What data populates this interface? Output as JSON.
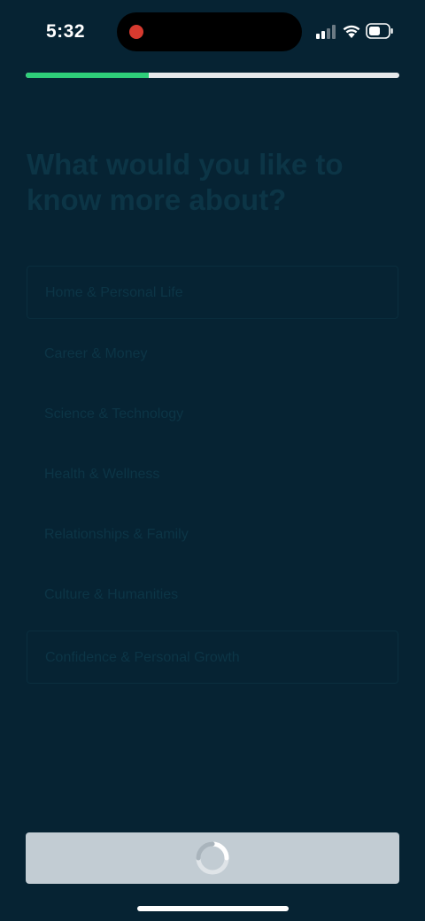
{
  "status_bar": {
    "time": "5:32",
    "signal_icon": "cellular-signal-icon",
    "wifi_icon": "wifi-icon",
    "battery_icon": "battery-icon",
    "recording_color": "#d63a2f"
  },
  "progress": {
    "value": 0.33,
    "fill_color": "#2ecf7a",
    "track_color": "#e6e8ea"
  },
  "step_label": "",
  "question": "What would you like to know more about?",
  "options": [
    {
      "label": "Home & Personal Life",
      "bordered": true
    },
    {
      "label": "Career & Money",
      "bordered": false
    },
    {
      "label": "Science & Technology",
      "bordered": false
    },
    {
      "label": "Health & Wellness",
      "bordered": false
    },
    {
      "label": "Relationships & Family",
      "bordered": false
    },
    {
      "label": "Culture & Humanities",
      "bordered": false
    },
    {
      "label": "Confidence & Personal Growth",
      "bordered": true
    }
  ],
  "button": {
    "state": "loading",
    "icon": "loading-spinner-icon",
    "color": "#c2ccd3"
  },
  "colors": {
    "background": "#062333"
  }
}
